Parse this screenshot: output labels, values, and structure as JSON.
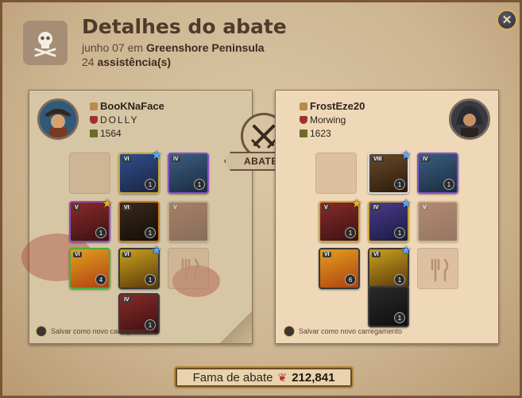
{
  "header": {
    "title": "Detalhes do abate",
    "date": "junho 07",
    "location_prefix": "em",
    "location": "Greenshore Peninsula",
    "assist_count": "24",
    "assist_label": "assistência(s)"
  },
  "center": {
    "ribbon_label": "ABATEU",
    "icon": "crossed-swords-icon"
  },
  "killer": {
    "name": "BooKNaFace",
    "guild": "DOLLY",
    "ip": "1564",
    "save_label": "Salvar como novo carregamento"
  },
  "victim": {
    "name": "FrostEze20",
    "guild": "Morwing",
    "ip": "1623",
    "save_label": "Salvar como novo carregamento"
  },
  "fame": {
    "label": "Fama de abate",
    "value": "212,841",
    "icon": "blood-drop-icon"
  },
  "colors": {
    "accent_gold": "#b08a3a",
    "parchment": "#d6c6a5",
    "star_blue": "#5aa7ff"
  }
}
